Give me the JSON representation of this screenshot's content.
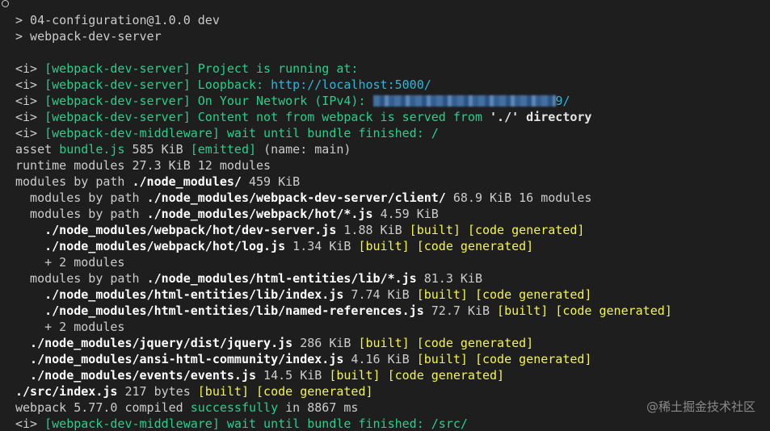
{
  "terminal": {
    "cmd1": "> 04-configuration@1.0.0 dev",
    "cmd2": "> webpack-dev-server",
    "prefix": "<i>",
    "wds_tag": "[webpack-dev-server]",
    "wdm_tag": "[webpack-dev-middleware]",
    "l1_msg": "Project is running at:",
    "l2_label": "Loopback: ",
    "l2_url": "http://localhost:5000/",
    "l3_label": "On Your Network (IPv4): ",
    "l3_tail": "9/",
    "l4_msg": "Content not from webpack is served from",
    "l4_path": "'./'",
    "l4_end": "directory",
    "l5_msg": "wait until bundle finished: /",
    "asset_word": "asset",
    "asset_file": "bundle.js",
    "asset_size": "585 KiB",
    "asset_flag": "[emitted]",
    "asset_name": "(name: main)",
    "runtime": "runtime modules 27.3 KiB 12 modules",
    "mbp_nm_pre": "modules by path",
    "mbp_nm_path": "./node_modules/",
    "mbp_nm_size": "459 KiB",
    "mbp_client_pre": "  modules by path",
    "mbp_client_path": "./node_modules/webpack-dev-server/client/",
    "mbp_client_size": "68.9 KiB 16 modules",
    "mbp_hot_pre": "  modules by path",
    "mbp_hot_path": "./node_modules/webpack/hot/*.js",
    "mbp_hot_size": "4.59 KiB",
    "f1_path": "    ./node_modules/webpack/hot/dev-server.js",
    "f1_size": "1.88 KiB",
    "f2_path": "    ./node_modules/webpack/hot/log.js",
    "f2_size": "1.34 KiB",
    "plus2a": "    + 2 modules",
    "mbp_he_pre": "  modules by path",
    "mbp_he_path": "./node_modules/html-entities/lib/*.js",
    "mbp_he_size": "81.3 KiB",
    "f3_path": "    ./node_modules/html-entities/lib/index.js",
    "f3_size": "7.74 KiB",
    "f4_path": "    ./node_modules/html-entities/lib/named-references.js",
    "f4_size": "72.7 KiB",
    "plus2b": "    + 2 modules",
    "f5_path": "  ./node_modules/jquery/dist/jquery.js",
    "f5_size": "286 KiB",
    "f6_path": "  ./node_modules/ansi-html-community/index.js",
    "f6_size": "4.16 KiB",
    "f7_path": "  ./node_modules/events/events.js",
    "f7_size": "14.5 KiB",
    "f8_path": "./src/index.js",
    "f8_size": "217 bytes",
    "built": "[built]",
    "codegen": "[code generated]",
    "compiled_pre": "webpack 5.77.0 compiled",
    "compiled_ok": "successfully",
    "compiled_time": "in 8867 ms",
    "last_msg": "wait until bundle finished: /src/"
  },
  "watermark": "@稀土掘金技术社区",
  "colors": {
    "background": "#1e1e1e",
    "green": "#23d18b",
    "cyan": "#29b8db",
    "yellow": "#f5f543"
  }
}
